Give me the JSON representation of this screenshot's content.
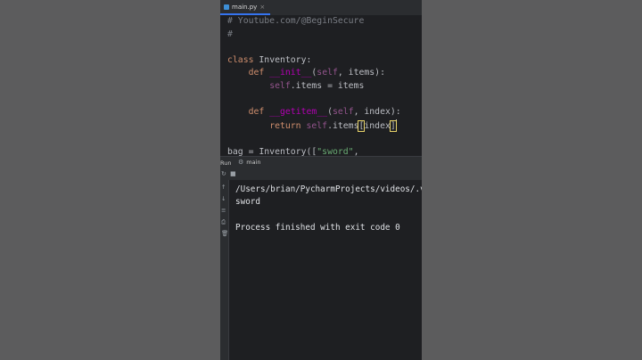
{
  "editor": {
    "tab": {
      "filename": "main.py",
      "close": "×"
    },
    "lines": {
      "l1": "# Youtube.com/@BeginSecure",
      "l2": "#",
      "l4_kw": "class",
      "l4_name": " Inventory:",
      "l5_kw": "def",
      "l5_fn": "__init__",
      "l5_rest_a": "(",
      "l5_self": "self",
      "l5_rest_b": ", items):",
      "l6_self": "self",
      "l6_rest": ".items = items",
      "l8_kw": "def",
      "l8_fn": "__getitem__",
      "l8_rest_a": "(",
      "l8_self": "self",
      "l8_rest_b": ", index):",
      "l9_kw": "return",
      "l9_self": "self",
      "l9_rest_a": ".items",
      "l9_b1": "[",
      "l9_rest_b": "index",
      "l9_b2": "]",
      "l11_a": "bag = Inventory([",
      "l11_str": "\"sword\"",
      "l11_b": ","
    }
  },
  "run": {
    "label": "Run",
    "tab": "main",
    "output": {
      "path": "/Users/brian/PycharmProjects/videos/.ver",
      "result": "sword",
      "status": "Process finished with exit code 0"
    }
  },
  "icons": {
    "gear": "⚙",
    "rerun": "↻",
    "stop": "■",
    "up": "↑",
    "down": "↓",
    "wrap": "≡",
    "print": "⎙",
    "trash": "🗑"
  },
  "colors": {
    "editor_bg": "#1e1f22",
    "panel_bg": "#2b2d30",
    "keyword": "#cf8e6d",
    "dunder": "#b200b2",
    "self": "#94558d",
    "string": "#6aab73",
    "comment": "#7a7e85"
  }
}
